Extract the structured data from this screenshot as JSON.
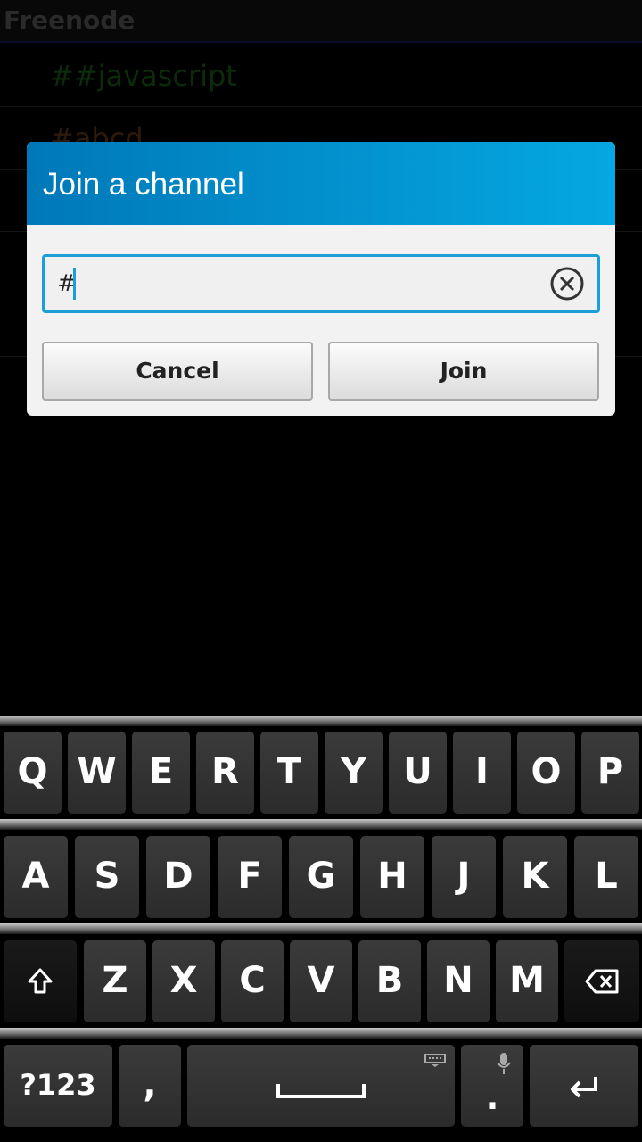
{
  "background": {
    "header_title": "Freenode",
    "rows": [
      "##javascript",
      "#abcd"
    ],
    "row_colors": [
      "#0c2a0c",
      "#2e1a0a"
    ]
  },
  "dialog": {
    "title": "Join a channel",
    "input_value": "#",
    "cancel_label": "Cancel",
    "join_label": "Join",
    "accent_color": "#1aa0d6"
  },
  "keyboard": {
    "row1": [
      "Q",
      "W",
      "E",
      "R",
      "T",
      "Y",
      "U",
      "I",
      "O",
      "P"
    ],
    "row2": [
      "A",
      "S",
      "D",
      "F",
      "G",
      "H",
      "J",
      "K",
      "L"
    ],
    "row3": [
      "Z",
      "X",
      "C",
      "V",
      "B",
      "N",
      "M"
    ],
    "symbols_label": "?123",
    "comma_label": ",",
    "period_label": ".",
    "icons": [
      "shift-icon",
      "backspace-icon",
      "space-icon",
      "keyboard-icon",
      "microphone-icon",
      "enter-icon"
    ]
  }
}
